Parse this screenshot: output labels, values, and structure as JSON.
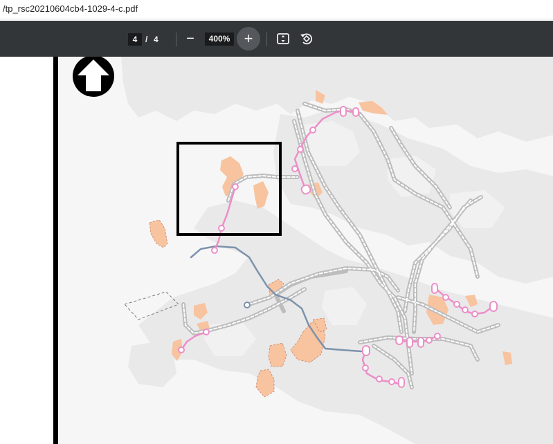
{
  "browser": {
    "url_text": "/tp_rsc20210604cb4-1029-4-c.pdf"
  },
  "toolbar": {
    "current_page": "4",
    "page_separator": "/",
    "total_pages": "4",
    "zoom_out_icon": "minus-icon",
    "zoom_level": "400%",
    "zoom_in_icon": "plus-icon",
    "fit_icon": "fit-to-page-icon",
    "rotate_icon": "rotate-icon"
  },
  "map": {
    "north_arrow_icon": "north-arrow-icon",
    "colors": {
      "land": "#e9e9e9",
      "sea": "#f6f6f6",
      "railway": "#bdbdbd",
      "proposed_line": "#ec8fc8",
      "new_link": "#7d92ab",
      "development_area": "#f8c39f",
      "highlight_box": "#000000"
    }
  }
}
